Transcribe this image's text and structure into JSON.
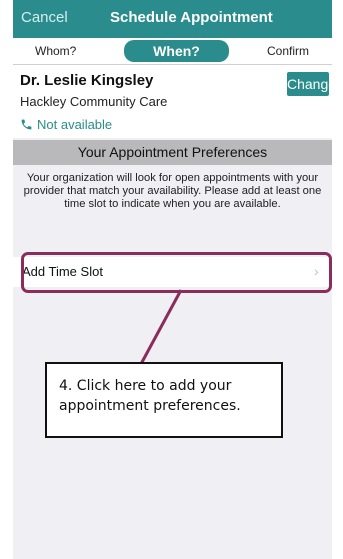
{
  "navbar": {
    "cancel_label": "Cancel",
    "title": "Schedule Appointment"
  },
  "steps": {
    "whom": "Whom?",
    "when": "When?",
    "confirm": "Confirm"
  },
  "provider": {
    "name": "Dr. Leslie Kingsley",
    "organization": "Hackley Community Care",
    "phone_status": "Not available",
    "change_label": "Change"
  },
  "preferences": {
    "header": "Your Appointment Preferences",
    "description": "Your organization will look for open appointments with your provider that match your availability. Please add at least one time slot to indicate when you are available.",
    "add_time_slot_label": "Add Time Slot",
    "chevron": "›"
  },
  "annotation": {
    "callout_text": "4. Click here to add your appointment preferences."
  },
  "colors": {
    "brand_teal": "#2a8c8c",
    "highlight_border": "#8a2c5c",
    "section_header": "#b9b9bc",
    "background": "#efeff4"
  },
  "icons": {
    "phone": "phone-icon",
    "chevron": "chevron-right-icon"
  }
}
